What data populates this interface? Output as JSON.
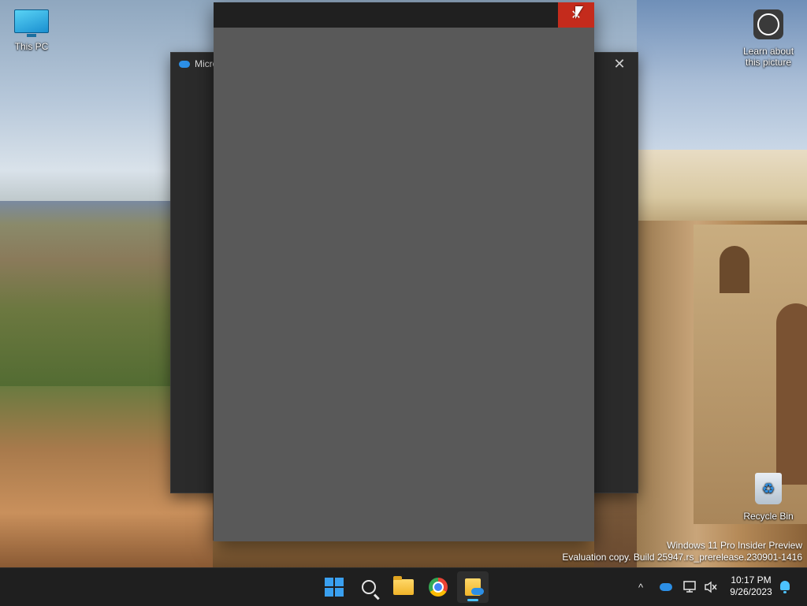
{
  "desktop": {
    "icons": [
      {
        "label": "This PC"
      },
      {
        "label": "Learn about this picture"
      },
      {
        "label": "Recycle Bin"
      }
    ],
    "watermark": {
      "line1": "Windows 11 Pro Insider Preview",
      "line2": "Evaluation copy. Build 25947.rs_prerelease.230901-1416"
    }
  },
  "windows": {
    "back": {
      "title": "Micro",
      "icon": "onedrive-cloud-icon",
      "close_glyph": "✕"
    },
    "front": {
      "title": "",
      "close_glyph": "✕",
      "close_color": "#c42b1c"
    }
  },
  "taskbar": {
    "items": [
      {
        "name": "start",
        "icon": "windows-logo-icon"
      },
      {
        "name": "search",
        "icon": "search-icon"
      },
      {
        "name": "file-explorer",
        "icon": "folder-icon"
      },
      {
        "name": "chrome",
        "icon": "chrome-icon"
      },
      {
        "name": "onedrive",
        "icon": "onedrive-folder-icon",
        "active": true
      }
    ],
    "tray": {
      "chevron": "^",
      "time": "10:17 PM",
      "date": "9/26/2023"
    }
  },
  "colors": {
    "accent": "#4cc2ff",
    "taskbar_bg": "#1f1f1f",
    "window_body": "#595959"
  }
}
